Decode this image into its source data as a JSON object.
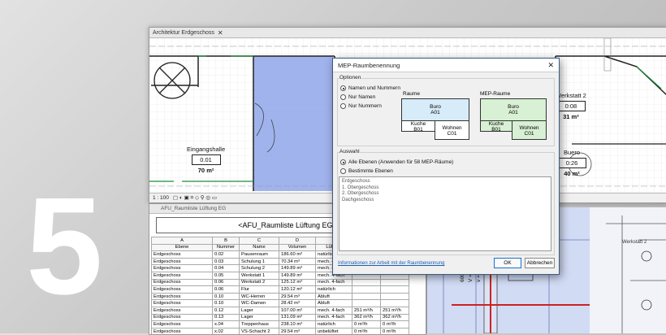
{
  "big_number": "5",
  "plan_window": {
    "tab_title": "Architektur Erdgeschoss",
    "scale": "1 : 100",
    "rooms": [
      {
        "name": "Eingangshalle",
        "number": "0.01",
        "area": "70 m²"
      },
      {
        "name": "Werkstatt 2",
        "number": "0:08",
        "area": "31 m²"
      },
      {
        "name": "Buero",
        "number": "0:26",
        "area": "40 m²"
      }
    ]
  },
  "schedule_window": {
    "tab_title": "AFU_Raumliste Lüftung EG",
    "title": "<AFU_Raumliste Lüftung EG>",
    "column_letters": [
      "A",
      "B",
      "C",
      "D",
      "E"
    ],
    "columns": [
      "Ebene",
      "Nummer",
      "Name",
      "Volumen",
      "Lüftung"
    ],
    "rows": [
      [
        "Erdgeschoss",
        "0.02",
        "Pausenraum",
        "186.60 m³",
        "natürlich",
        "",
        ""
      ],
      [
        "Erdgeschoss",
        "0.03",
        "Schulung 1",
        "70.34 m³",
        "mech. 4-fach",
        "",
        ""
      ],
      [
        "Erdgeschoss",
        "0.04",
        "Schulung 2",
        "149.89 m³",
        "mech. 4-fach",
        "",
        ""
      ],
      [
        "Erdgeschoss",
        "0.05",
        "Werkstatt 1",
        "149.89 m³",
        "mech. 4-fach",
        "",
        ""
      ],
      [
        "Erdgeschoss",
        "0.06",
        "Werkstatt 2",
        "125.12 m³",
        "mech. 4-fach",
        "",
        ""
      ],
      [
        "Erdgeschoss",
        "0.06",
        "Flur",
        "120.12 m³",
        "natürlich",
        "",
        ""
      ],
      [
        "Erdgeschoss",
        "0.10",
        "WC-Herren",
        "29.54 m³",
        "Abluft",
        "",
        ""
      ],
      [
        "Erdgeschoss",
        "0.10",
        "WC-Damen",
        "28.42 m³",
        "Abluft",
        "",
        ""
      ],
      [
        "Erdgeschoss",
        "0.12",
        "Lager",
        "107.00 m³",
        "mech. 4-fach",
        "251 m³/h",
        "251 m³/h"
      ],
      [
        "Erdgeschoss",
        "0.13",
        "Lager",
        "131.09 m³",
        "mech. 4-fach",
        "362 m³/h",
        "362 m³/h"
      ],
      [
        "Erdgeschoss",
        "x.04",
        "Treppenhaus",
        "238.10 m³",
        "natürlich",
        "0 m³/h",
        "0 m³/h"
      ],
      [
        "Erdgeschoss",
        "x.02",
        "VS-Schacht 2",
        "29.54 m³",
        "unbelüftet",
        "0 m³/h",
        "0 m³/h"
      ],
      [
        "Erdgeschoss",
        "x.03",
        "VS-Schacht 1",
        "48.44 m³",
        "unbelüftet",
        "0 m³/h",
        "0 m³/h"
      ],
      [
        "Erdgeschoss",
        "x.01",
        "Aufzug",
        "69.26 m³",
        "unbelüftet",
        "0 m³/h",
        "0 m³/h"
      ]
    ]
  },
  "view3d": {
    "label": "Werkstatt 2",
    "duct_labels": [
      "600x250",
      "V = 490 m³/h",
      "v = 0.4 m/s"
    ]
  },
  "dialog": {
    "title": "MEP-Raumbenennung",
    "options_label": "Optionen",
    "radio_options": [
      {
        "label": "Namen und Nummern",
        "checked": true
      },
      {
        "label": "Nur Namen",
        "checked": false
      },
      {
        "label": "Nur Nummern",
        "checked": false
      }
    ],
    "raeume_label": "Raume",
    "mep_raeume_label": "MEP-Raume",
    "raeume_boxes": {
      "top_name": "Buro",
      "top_num": "A01",
      "left_name": "Kuche",
      "left_num": "B01",
      "right_name": "Wohnen",
      "right_num": "C01"
    },
    "mep_boxes": {
      "top_name": "Buro",
      "top_num": "A01",
      "left_name": "Kuche",
      "left_num": "B01",
      "right_name": "Wohnen",
      "right_num": "C01"
    },
    "auswahl_label": "Auswahl",
    "auswahl_options": [
      {
        "label": "Alle Ebenen  (Anwenden für 58 MEP-Räume)",
        "checked": true
      },
      {
        "label": "Bestimmte Ebenen",
        "checked": false
      }
    ],
    "levels": [
      "Erdgeschoss",
      "1. Obergeschoss",
      "2. Obergeschoss",
      "Dachgeschoss"
    ],
    "info_link": "Informationen zur Arbeit mit der Raumbenennung",
    "ok_label": "OK",
    "cancel_label": "Abbrechen"
  },
  "colors": {
    "accent_blue": "#8aa3e8",
    "mep_green": "#d8f0d4",
    "room_light_blue": "#d6ecf8",
    "duct_red": "#cc2222"
  }
}
